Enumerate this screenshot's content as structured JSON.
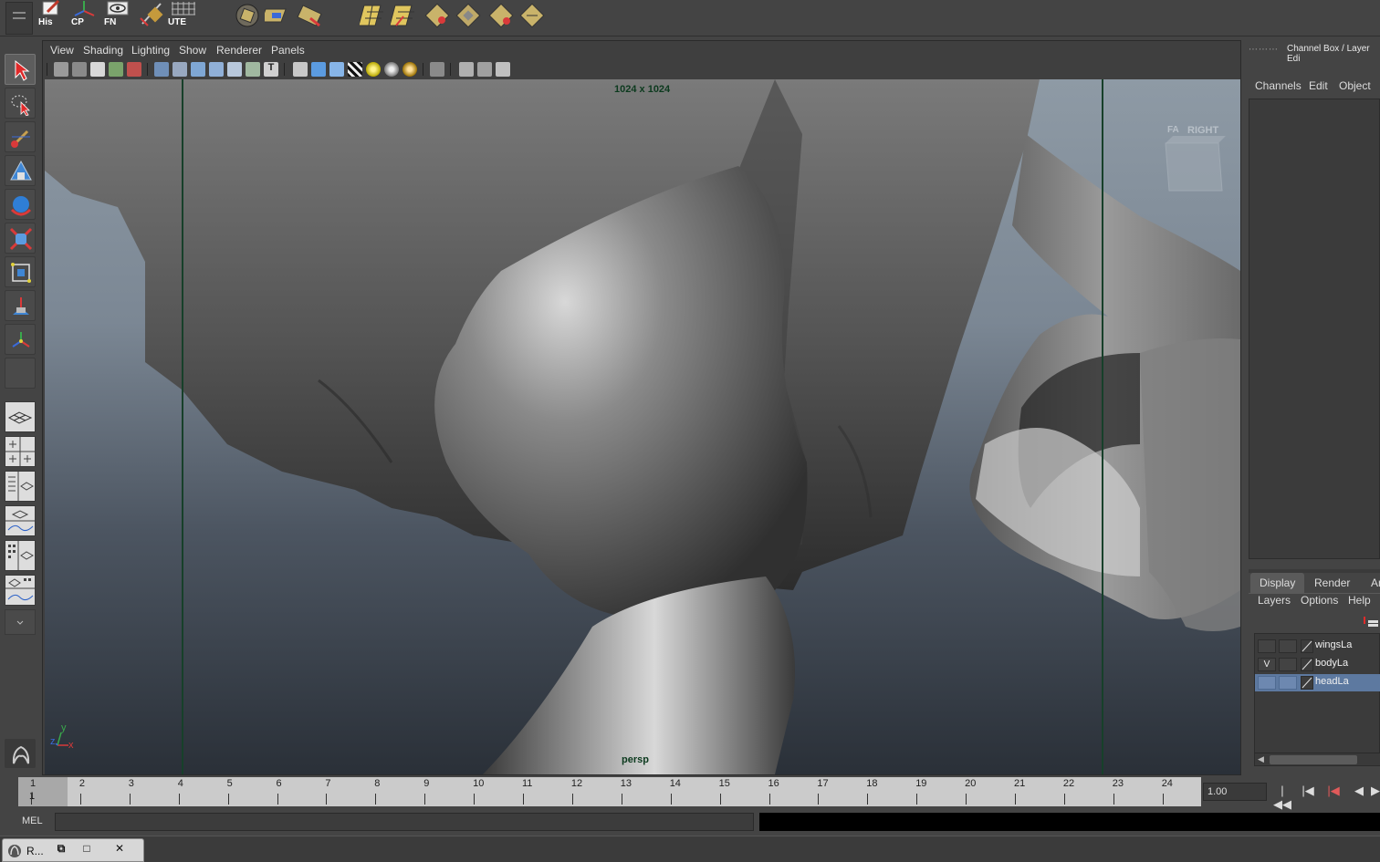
{
  "shelf": {
    "buttons": [
      {
        "label": "His",
        "icon": "pencil-doc-icon"
      },
      {
        "label": "CP",
        "icon": "center-pivot-icon"
      },
      {
        "label": "FN",
        "icon": "eye-icon"
      },
      {
        "label": "",
        "icon": "freeze-transform-icon"
      },
      {
        "label": "UTE",
        "icon": "grid-icon"
      }
    ],
    "uv_buttons": [
      "uv-layout-icon",
      "uv-planar-icon",
      "uv-cut-icon",
      "uv-unfold-1-icon",
      "uv-unfold-2-icon",
      "uv-select-1-icon",
      "uv-select-2-icon",
      "uv-relax-icon",
      "uv-sew-icon"
    ]
  },
  "panel": {
    "menu": [
      "View",
      "Shading",
      "Lighting",
      "Show",
      "Renderer",
      "Panels"
    ],
    "resolution_gate": "1024 x 1024",
    "camera": "persp",
    "viewcube_label": "RIGHT",
    "viewcube_label_side": "FA",
    "axis_x": "x",
    "axis_y": "y",
    "axis_z": "z"
  },
  "channel_box": {
    "title": "Channel Box / Layer Edi",
    "menu": [
      "Channels",
      "Edit",
      "Object"
    ]
  },
  "layer_editor": {
    "tabs": [
      "Display",
      "Render",
      "An"
    ],
    "active_tab": "Display",
    "menu": [
      "Layers",
      "Options",
      "Help"
    ],
    "layers": [
      {
        "name": "wingsLa",
        "visible": "",
        "selected": false
      },
      {
        "name": "bodyLa",
        "visible": "V",
        "selected": false
      },
      {
        "name": "headLa",
        "visible": "",
        "selected": true
      }
    ]
  },
  "time_slider": {
    "ticks": [
      "1",
      "2",
      "3",
      "4",
      "5",
      "6",
      "7",
      "8",
      "9",
      "10",
      "11",
      "12",
      "13",
      "14",
      "15",
      "16",
      "17",
      "18",
      "19",
      "20",
      "21",
      "22",
      "23",
      "24"
    ],
    "current_frame": "1",
    "field_value": "1.00"
  },
  "command_line": {
    "label": "MEL"
  },
  "taskbar": {
    "item_label": "R..."
  },
  "colors": {
    "ui_bg": "#444444",
    "layer_selected": "#5d79a0",
    "gate_line": "#17402a",
    "hud_text": "#0c3a1e"
  }
}
